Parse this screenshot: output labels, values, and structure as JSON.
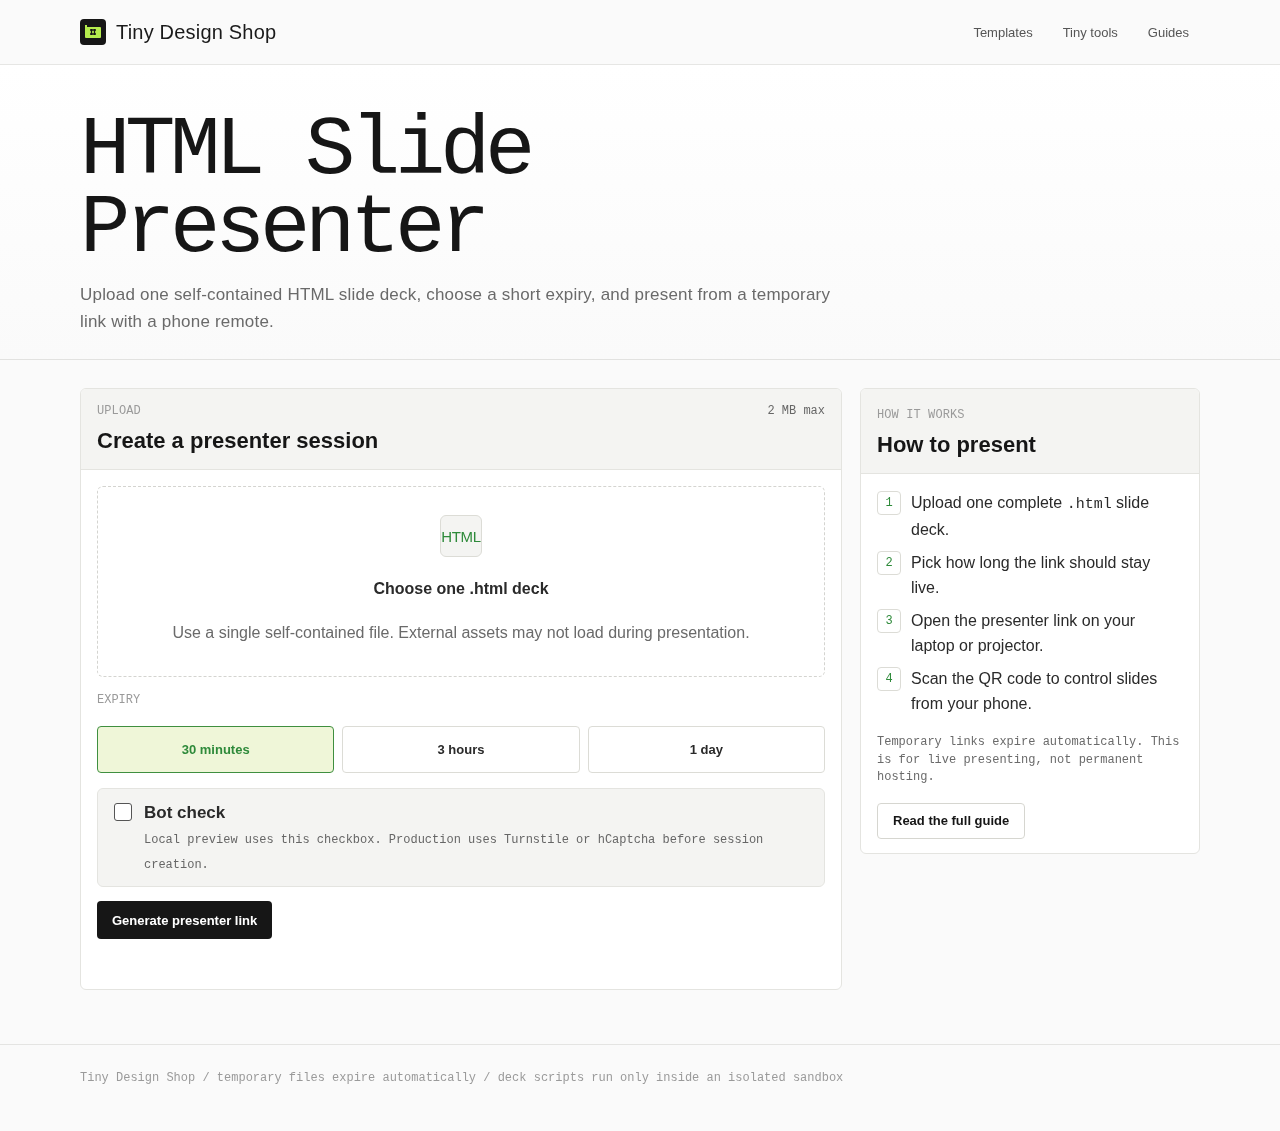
{
  "header": {
    "brand": "Tiny Design Shop",
    "nav": [
      "Templates",
      "Tiny tools",
      "Guides"
    ]
  },
  "hero": {
    "title": [
      "HTML Slide",
      "Presenter"
    ],
    "subtitle": "Upload one self-contained HTML slide deck, choose a short expiry, and present from a temporary link with a phone remote."
  },
  "upload_card": {
    "eyebrow": "UPLOAD",
    "limit": "2 MB max",
    "title": "Create a presenter session",
    "dropzone": {
      "file_type": "HTML",
      "title": "Choose one .html deck",
      "hint": "Use a single self-contained file. External assets may not load during presentation."
    },
    "expiry_label": "EXPIRY",
    "expiry_options": [
      {
        "label": "30 minutes",
        "selected": true
      },
      {
        "label": "3 hours",
        "selected": false
      },
      {
        "label": "1 day",
        "selected": false
      }
    ],
    "bot_check": {
      "label": "Bot check",
      "checked": false,
      "description": "Local preview uses this checkbox. Production uses Turnstile or hCaptcha before session creation."
    },
    "submit": "Generate presenter link"
  },
  "guide_card": {
    "eyebrow": "HOW IT WORKS",
    "title": "How to present",
    "steps": [
      {
        "number": "1",
        "parts": [
          {
            "kind": "text",
            "text": "Upload one complete "
          },
          {
            "kind": "code",
            "text": ".html"
          },
          {
            "kind": "text",
            "text": " slide deck."
          }
        ]
      },
      {
        "number": "2",
        "parts": [
          {
            "kind": "text",
            "text": "Pick how long the link should stay live."
          }
        ]
      },
      {
        "number": "3",
        "parts": [
          {
            "kind": "text",
            "text": "Open the presenter link on your laptop or projector."
          }
        ]
      },
      {
        "number": "4",
        "parts": [
          {
            "kind": "text",
            "text": "Scan the QR code to control slides from your phone."
          }
        ]
      }
    ],
    "note": "Temporary links expire automatically. This is for live presenting, not permanent hosting.",
    "button": "Read the full guide"
  },
  "footer": {
    "text": "Tiny Design Shop / temporary files expire automatically / deck scripts run only inside an isolated sandbox"
  }
}
